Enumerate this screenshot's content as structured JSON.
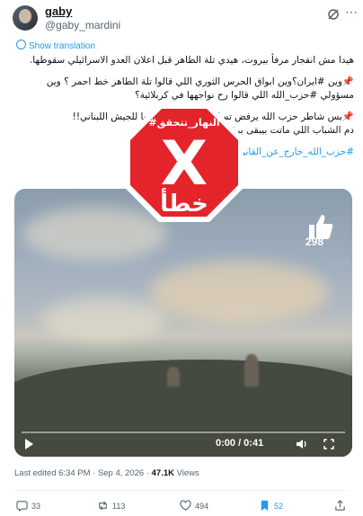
{
  "author": {
    "name": "gaby",
    "handle": "@gaby_mardini"
  },
  "translate_label": "Show translation",
  "tweet": {
    "line1": "هيدا مش انفجار مرفأ بيروت، هيدي تلة الطاهر قبل اعلان العدو الاسرائيلي سقوطها.",
    "p2_line1": "📌وين #ايران؟وين ابواق الحرس الثوري اللي قالوا تلة الطاهر خط احمر ؟ وين",
    "p2_line2": "مسؤولي #حزب_الله اللي قالوا رح نواجهها في كربلائية؟",
    "p3_line1": "📌بس شاطر حزب الله يرفض تسليم سلاحه و تسليمها للجيش اللبناني!!",
    "p3_line2": "دم الشباب اللي ماتت بيبقى برقبتك يا شيخ نعيم.",
    "hashtag_footer": "#حزب_الله_خارج_عن_القانون"
  },
  "video": {
    "time": "0:00 / 0:41",
    "reaction_count": "298"
  },
  "stamp": {
    "top_text": "#النهار_تتحقق",
    "verdict": "خطأ",
    "mark": "X"
  },
  "meta": {
    "edited": "Last edited 6:34 PM · Sep 4, 2026 · ",
    "views_count": "47.1K",
    "views_label": " Views"
  },
  "actions": {
    "replies": "33",
    "reposts": "113",
    "likes": "494",
    "bookmarks": "52"
  },
  "colors": {
    "accent": "#1d9bf0",
    "stamp_red": "#e3242b"
  }
}
